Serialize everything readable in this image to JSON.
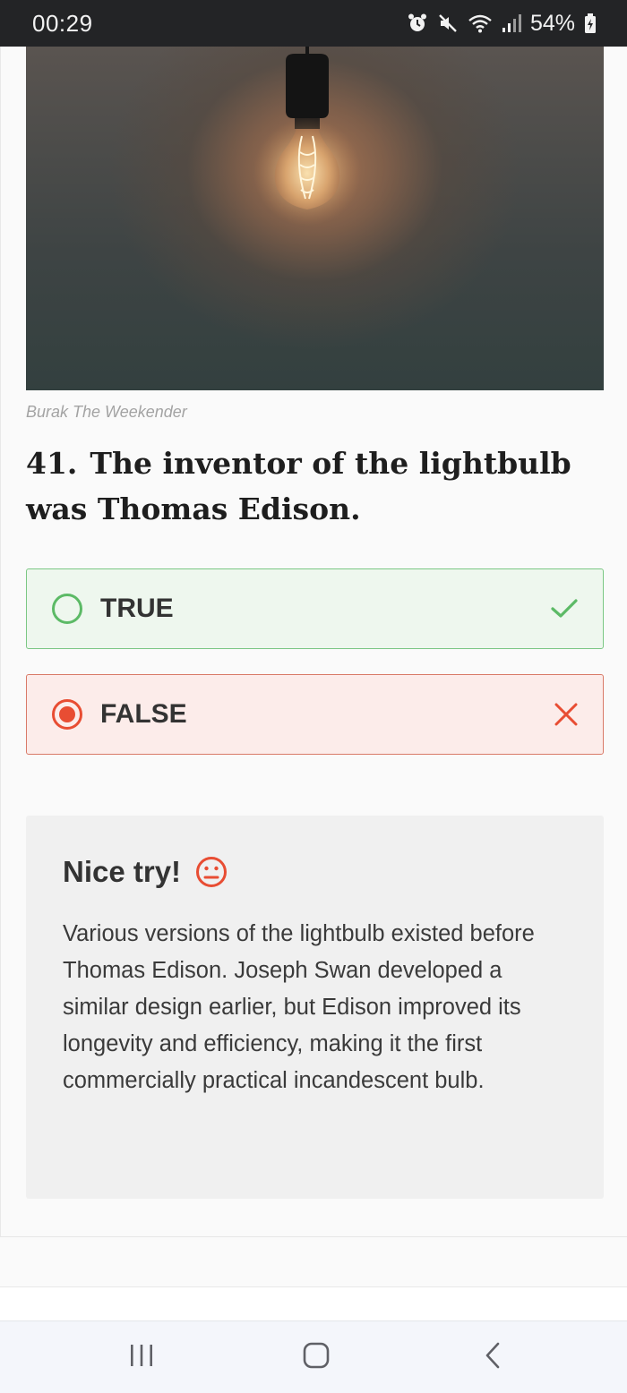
{
  "status_bar": {
    "time": "00:29",
    "battery": "54%",
    "icons": [
      "alarm-icon",
      "mute-icon",
      "wifi-icon",
      "signal-icon",
      "battery-charging-icon"
    ]
  },
  "image": {
    "caption": "Burak The Weekender",
    "subject": "lightbulb-photo"
  },
  "question": {
    "number": "41.",
    "text": "The inventor of the lightbulb was Thomas Edison."
  },
  "options": [
    {
      "label": "TRUE",
      "state": "correct",
      "selected": false,
      "mark": "check-icon",
      "accent": "#5cba66"
    },
    {
      "label": "FALSE",
      "state": "wrong",
      "selected": true,
      "mark": "close-icon",
      "accent": "#e84d33"
    }
  ],
  "feedback": {
    "title": "Nice try!",
    "emoji": "neutral-face-icon",
    "body": "Various versions of the lightbulb existed before Thomas Edison. Joseph Swan developed a similar design earlier, but Edison improved its longevity and efficiency, making it the first commercially practical incandescent bulb."
  },
  "nav_bar": {
    "buttons": [
      "recents-icon",
      "home-icon",
      "back-icon"
    ]
  },
  "colors": {
    "correct": "#5cba66",
    "wrong": "#e84d33",
    "status_bar_bg": "#232426"
  }
}
